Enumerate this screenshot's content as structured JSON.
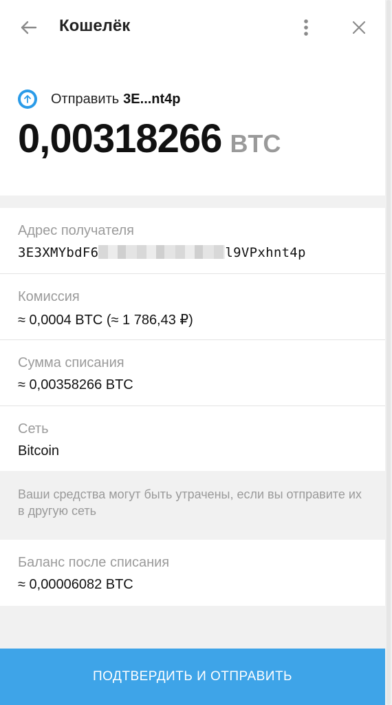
{
  "header": {
    "title": "Кошелёк",
    "back_icon": "arrow-left-icon",
    "more_icon": "more-vertical-icon",
    "close_icon": "close-icon"
  },
  "summary": {
    "send_label": "Отправить",
    "send_address_short": "3E...nt4p",
    "amount": "0,00318266",
    "currency": "BTC",
    "send_icon": "arrow-up-circle-icon",
    "accent_color": "#2a9be8"
  },
  "details": {
    "recipient": {
      "label": "Адрес получателя",
      "value_start": "3E3XMYbdF6",
      "value_end": "l9VPxhnt4p"
    },
    "fee": {
      "label": "Комиссия",
      "value": "≈ 0,0004 BTC (≈ 1 786,43 ₽)"
    },
    "total": {
      "label": "Сумма списания",
      "value": "≈ 0,00358266 BTC"
    },
    "network": {
      "label": "Сеть",
      "value": "Bitcoin"
    }
  },
  "warning": {
    "text": "Ваши средства могут быть утрачены, если вы отправите их в другую сеть"
  },
  "balance": {
    "label": "Баланс после списания",
    "value": "≈ 0,00006082 BTC"
  },
  "confirm": {
    "label": "ПОДТВЕРДИТЬ И ОТПРАВИТЬ",
    "color": "#3ea4e8"
  }
}
